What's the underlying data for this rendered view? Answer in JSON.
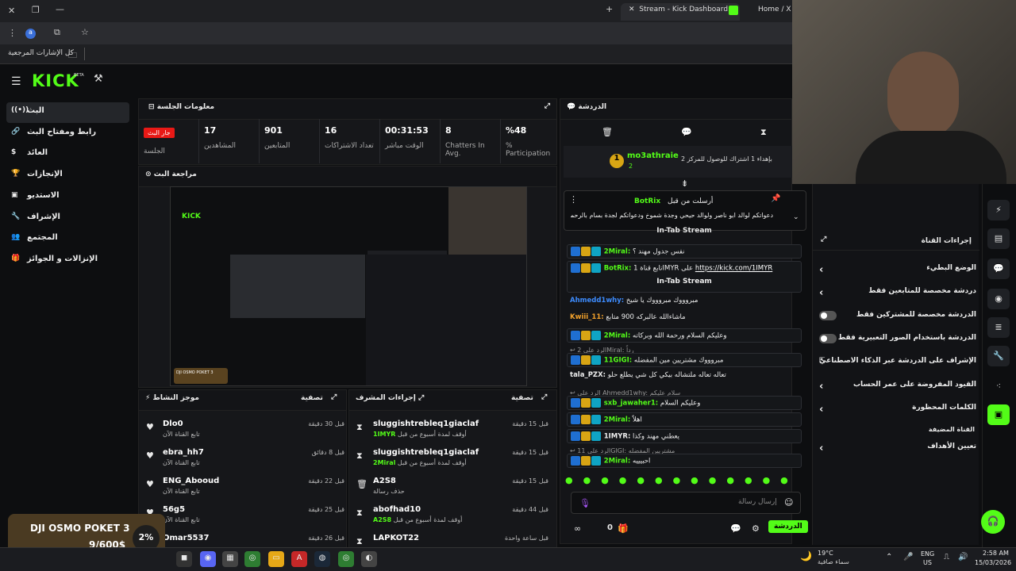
{
  "browser": {
    "tabs": [
      "Stream - Kick Dashboard",
      "Home / X"
    ],
    "bookmarks_label": "كل الإشارات المرجعية",
    "profile": "a"
  },
  "kick": {
    "logo": "KICK",
    "beta": "BETA"
  },
  "sidebar": {
    "items": [
      {
        "label": "البث",
        "icon": "broadcast-icon",
        "active": true
      },
      {
        "label": "رابط ومفتاح البث",
        "icon": "link-icon"
      },
      {
        "label": "العائد",
        "icon": "money-icon"
      },
      {
        "label": "الإنجازات",
        "icon": "trophy-icon"
      },
      {
        "label": "الاستديو",
        "icon": "studio-icon"
      },
      {
        "label": "الإشراف",
        "icon": "wrench-icon"
      },
      {
        "label": "المجتمع",
        "icon": "community-icon"
      },
      {
        "label": "الإنزالات و الجوائز",
        "icon": "gift-icon"
      }
    ]
  },
  "session": {
    "title": "معلومات الجلسة",
    "live_badge": "جار البث",
    "live_label": "الجلسة",
    "stats": [
      {
        "value": "17",
        "label": "المشاهدين"
      },
      {
        "value": "901",
        "label": "المتابعين"
      },
      {
        "value": "16",
        "label": "تعداد الاشتراكات"
      },
      {
        "value": "00:31:53",
        "label": "الوقت مباشر"
      },
      {
        "value": "8",
        "label": "Chatters In Avg."
      },
      {
        "value": "%48",
        "label": "% Participation"
      }
    ]
  },
  "preview": {
    "title": "مراجعة البث",
    "overlay_title": "DJI OSMO POKET 3",
    "overlay_pct": "2%",
    "overlay_amount": "9/600$"
  },
  "activity": {
    "title": "موجز النشاط",
    "filter": "تصفية",
    "items": [
      {
        "name": "Dlo0",
        "desc": "تابع القناة الآن",
        "time": "قبل 30 دقيقة"
      },
      {
        "name": "ebra_hh7",
        "desc": "تابع القناة الآن",
        "time": "قبل 8 دقائق"
      },
      {
        "name": "ENG_Abooud",
        "desc": "تابع القناة الآن",
        "time": "قبل 22 دقيقة"
      },
      {
        "name": "56g5",
        "desc": "تابع القناة الآن",
        "time": "قبل 25 دقيقة"
      },
      {
        "name": "Omar5537",
        "desc": "",
        "time": "قبل 26 دقيقة"
      }
    ]
  },
  "modactions": {
    "title": "إجراءات المشرف",
    "filter": "تصفية",
    "items": [
      {
        "name": "sluggishtrebleq1giaclaf",
        "desc": "أوقف لمدة أسبوع من قبل",
        "by": "1IMYR",
        "time": "قبل 15 دقيقة"
      },
      {
        "name": "sluggishtrebleq1giaclaf",
        "desc": "أوقف لمدة أسبوع من قبل",
        "by": "2Miral",
        "time": "قبل 15 دقيقة"
      },
      {
        "name": "A2S8",
        "desc": "حذف رسالة",
        "by": "",
        "time": "قبل 15 دقيقة"
      },
      {
        "name": "abofhad10",
        "desc": "أوقف لمدة أسبوع من قبل",
        "by": "A2S8",
        "time": "قبل 44 دقيقة"
      },
      {
        "name": "LAPKOT22",
        "desc": "",
        "by": "",
        "time": "قبل ساعة واحدة"
      }
    ]
  },
  "chat": {
    "title": "الدردشة",
    "pinned_user": "mo3athraie",
    "pinned_rank": "1",
    "pinned_sub": "2",
    "pinned_text": "بإهداء 1 اشتراك للوصول للمركز 2",
    "pinned_by": "أرسلت من قبل",
    "pinned_bot": "BotRix",
    "pinned_msg": "دعواتكم لوالد ابو ناصر ولوالد حيحي وجدة شموخ ودعواتكم لجدة بسام بالرحمه",
    "intab": "In-Tab Stream",
    "messages": [
      {
        "user": "2Miral:",
        "text": "نفس جدول مهند ؟",
        "color": "#53fc18"
      },
      {
        "user": "BotRix:",
        "text": "تابع قناة 1IMYR على",
        "link": "https://kick.com/1IMYR",
        "color": "#53fc18"
      },
      {
        "user": "Ahmedd1why:",
        "text": "مبروووك مبروووك يا شيخ",
        "color": "#3d8bfd"
      },
      {
        "user": "Kwiii_11:",
        "text": "ماشاءالله عالبركه 900 متابع",
        "color": "#f2a12b"
      },
      {
        "user": "2Miral:",
        "text": "وعليكم السلام ورحمة الله وبركاته",
        "color": "#53fc18"
      },
      {
        "reply": "الرد على 2Miral: رداً"
      },
      {
        "user": "11GIGI:",
        "text": "مبروووك مشتريين مين المفضله",
        "color": "#53fc18"
      },
      {
        "user": "tala_PZX:",
        "text": "تعاله تعاله ملتشاله بيكي كل شي يطلع حلو",
        "color": "#eee"
      },
      {
        "reply": "الرد على Ahmedd1why: سلام عليكم"
      },
      {
        "user": "sxb_jawaher1:",
        "text": "وعليكم السلام",
        "color": "#53fc18"
      },
      {
        "user": "2Miral:",
        "text": "اهلاً",
        "color": "#53fc18"
      },
      {
        "user": "1IMYR:",
        "text": "يعطني مهند وكذا",
        "color": "#eee"
      },
      {
        "reply": "الرد على 11GIGI: مشتريين المفضله"
      },
      {
        "user": "2Miral:",
        "text": "احبيييه",
        "color": "#53fc18"
      }
    ],
    "input_placeholder": "إرسال رسالة",
    "send_label": "الدردشة",
    "viewer_count": "0"
  },
  "channel_actions": {
    "title": "إجراءات القناة",
    "items": [
      {
        "label": "الوضع البطيء",
        "type": "arrow"
      },
      {
        "label": "دردشة مخصصة للمتابعين فقط",
        "type": "arrow"
      },
      {
        "label": "الدردشة مخصصة للمشتركين فقط",
        "type": "toggle"
      },
      {
        "label": "الدردشة باستخدام الصور التعبيرية فقط",
        "type": "toggle"
      },
      {
        "label": "الإشراف على الدردشة عبر الذكاء الاصطناعي",
        "type": "external"
      },
      {
        "label": "القيود المفروضة على عمر الحساب",
        "type": "arrow"
      },
      {
        "label": "الكلمات المحظورة",
        "type": "arrow"
      }
    ],
    "section": "القناة المضيفة",
    "host_item": "تعيين الأهداف"
  },
  "taskbar": {
    "temp": "19°C",
    "weather": "سماء صافية",
    "lang1": "ENG",
    "lang2": "US",
    "time": "2:58 AM",
    "date": "15/03/2026"
  },
  "colors": {
    "accent": "#53fc18",
    "live": "#e91916",
    "bg": "#0d0e10",
    "panel": "#16171a"
  }
}
